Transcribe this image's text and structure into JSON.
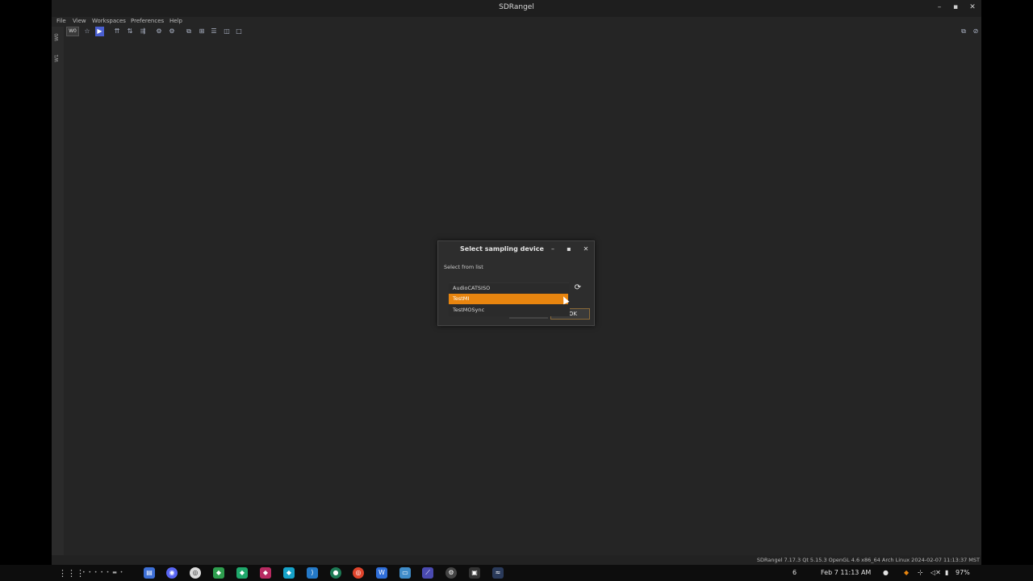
{
  "window": {
    "title": "SDRangel",
    "controls": {
      "minimize": "–",
      "maximize": "▪",
      "close": "✕"
    }
  },
  "menu": [
    "File",
    "View",
    "Workspaces",
    "Preferences",
    "Help"
  ],
  "toolbar": {
    "workspace_label": "W0"
  },
  "sidebar": {
    "tabs": [
      "W0",
      "W1"
    ]
  },
  "status_bar": {
    "text": "SDRangel 7.17.3 Qt 5.15.3 OpenGL 4.6 x86_64 Arch Linux  2024-02-07 11:13:37 MST"
  },
  "dialog": {
    "title": "Select sampling device",
    "label": "Select from list",
    "options": [
      "AudioCATSISO",
      "TestMI",
      "TestMOSync"
    ],
    "selected_option": "TestMI",
    "ok_label": "OK",
    "accent_color": "#e8850f"
  },
  "taskbar": {
    "workspace_number": "6",
    "datetime": "Feb 7  11:13 AM",
    "battery": "97%"
  }
}
